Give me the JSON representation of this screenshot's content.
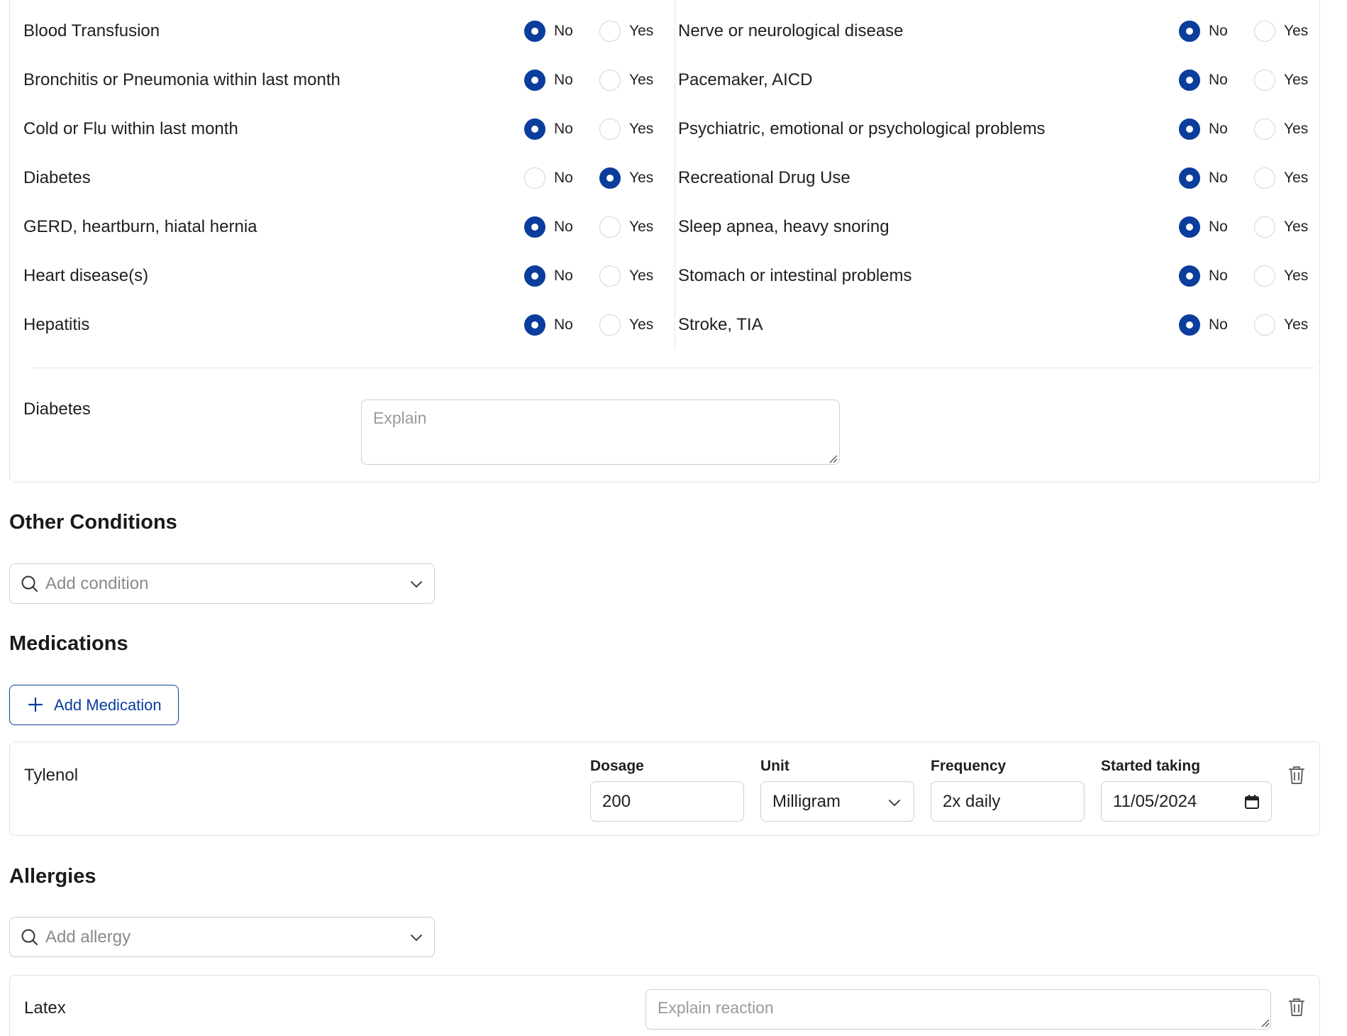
{
  "conditions_left": [
    {
      "label": "Blood Transfusion",
      "value": "No"
    },
    {
      "label": "Bronchitis or Pneumonia within last month",
      "value": "No"
    },
    {
      "label": "Cold or Flu within last month",
      "value": "No"
    },
    {
      "label": "Diabetes",
      "value": "Yes"
    },
    {
      "label": "GERD, heartburn, hiatal hernia",
      "value": "No"
    },
    {
      "label": "Heart disease(s)",
      "value": "No"
    },
    {
      "label": "Hepatitis",
      "value": "No"
    }
  ],
  "conditions_right": [
    {
      "label": "Nerve or neurological disease",
      "value": "No"
    },
    {
      "label": "Pacemaker, AICD",
      "value": "No"
    },
    {
      "label": "Psychiatric, emotional or psychological problems",
      "value": "No"
    },
    {
      "label": "Recreational Drug Use",
      "value": "No"
    },
    {
      "label": "Sleep apnea, heavy snoring",
      "value": "No"
    },
    {
      "label": "Stomach or intestinal problems",
      "value": "No"
    },
    {
      "label": "Stroke, TIA",
      "value": "No"
    }
  ],
  "options": {
    "no": "No",
    "yes": "Yes"
  },
  "explain": {
    "label": "Diabetes",
    "placeholder": "Explain"
  },
  "other_conditions": {
    "title": "Other Conditions",
    "placeholder": "Add condition"
  },
  "medications": {
    "title": "Medications",
    "add_label": "Add Medication",
    "items": [
      {
        "name": "Tylenol",
        "dosage_label": "Dosage",
        "dosage": "200",
        "unit_label": "Unit",
        "unit": "Milligram",
        "frequency_label": "Frequency",
        "frequency": "2x daily",
        "started_label": "Started taking",
        "started": "11/05/2024"
      }
    ]
  },
  "allergies": {
    "title": "Allergies",
    "placeholder": "Add allergy",
    "items": [
      {
        "name": "Latex",
        "reaction_placeholder": "Explain reaction"
      }
    ]
  },
  "colors": {
    "accent": "#0a3d9c",
    "border": "#cfcfcf"
  }
}
